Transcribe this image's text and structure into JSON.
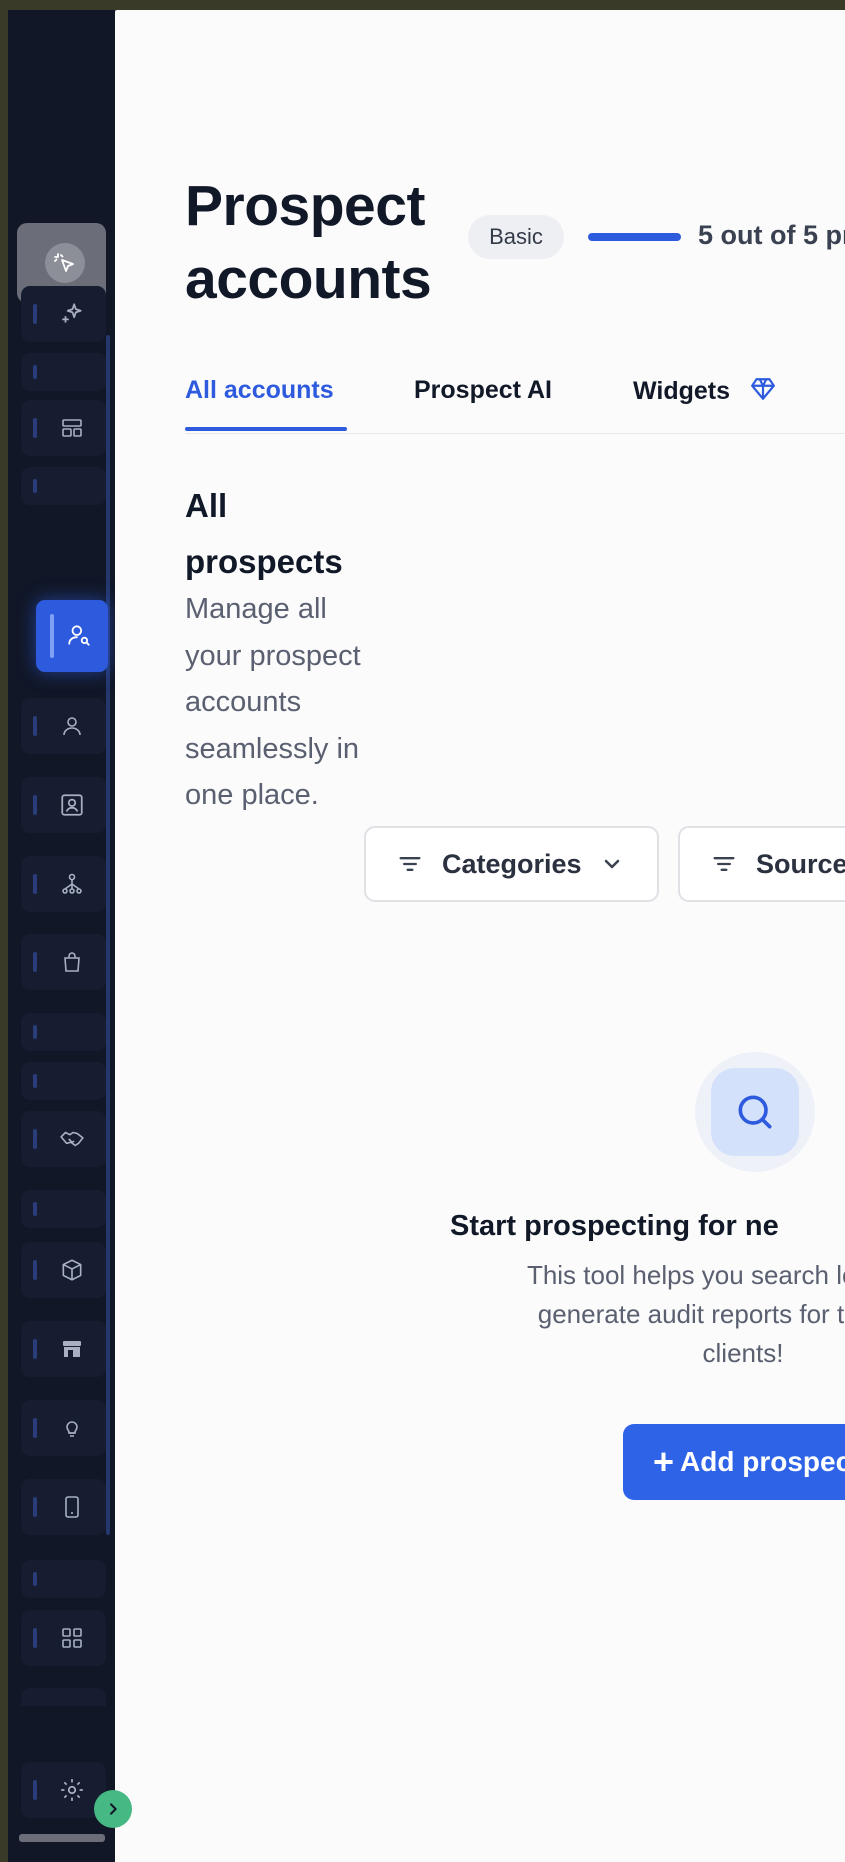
{
  "header": {
    "title": "Prospect accounts",
    "plan_badge": "Basic",
    "usage_text": "5 out of 5 pr",
    "usage_progress": 1.0
  },
  "tabs": [
    {
      "label": "All accounts",
      "active": true
    },
    {
      "label": "Prospect AI",
      "active": false
    },
    {
      "label": "Widgets",
      "active": false,
      "icon": "diamond-icon"
    }
  ],
  "section": {
    "title": "All prospects",
    "description": "Manage all your prospect accounts seamlessly in one place."
  },
  "filters": [
    {
      "label": "Categories",
      "icon": "filter-icon",
      "has_dropdown": true
    },
    {
      "label": "Source",
      "icon": "filter-icon"
    }
  ],
  "empty_state": {
    "icon": "search-icon",
    "title": "Start prospecting for ne",
    "description_lines": [
      "This tool helps you search local busin",
      "generate audit reports for them. Sta",
      "clients!"
    ],
    "button_label": "Add prospec"
  },
  "sidebar": {
    "logo_icon": "cursor-click-icon",
    "items": [
      {
        "icon": "sparkle-icon"
      },
      {
        "icon": "layout-icon"
      },
      {
        "icon": "user-search-icon",
        "active": true
      },
      {
        "icon": "user-icon"
      },
      {
        "icon": "contact-card-icon"
      },
      {
        "icon": "hierarchy-icon"
      },
      {
        "icon": "shopping-bag-icon"
      },
      {
        "icon": "handshake-icon"
      },
      {
        "icon": "package-icon"
      },
      {
        "icon": "store-icon"
      },
      {
        "icon": "lightbulb-icon"
      },
      {
        "icon": "mobile-icon"
      },
      {
        "icon": "grid-icon"
      },
      {
        "icon": "settings-icon"
      }
    ]
  },
  "colors": {
    "accent": "#2e5bde",
    "sidebar_bg": "#111727",
    "expand_button": "#46b884"
  }
}
